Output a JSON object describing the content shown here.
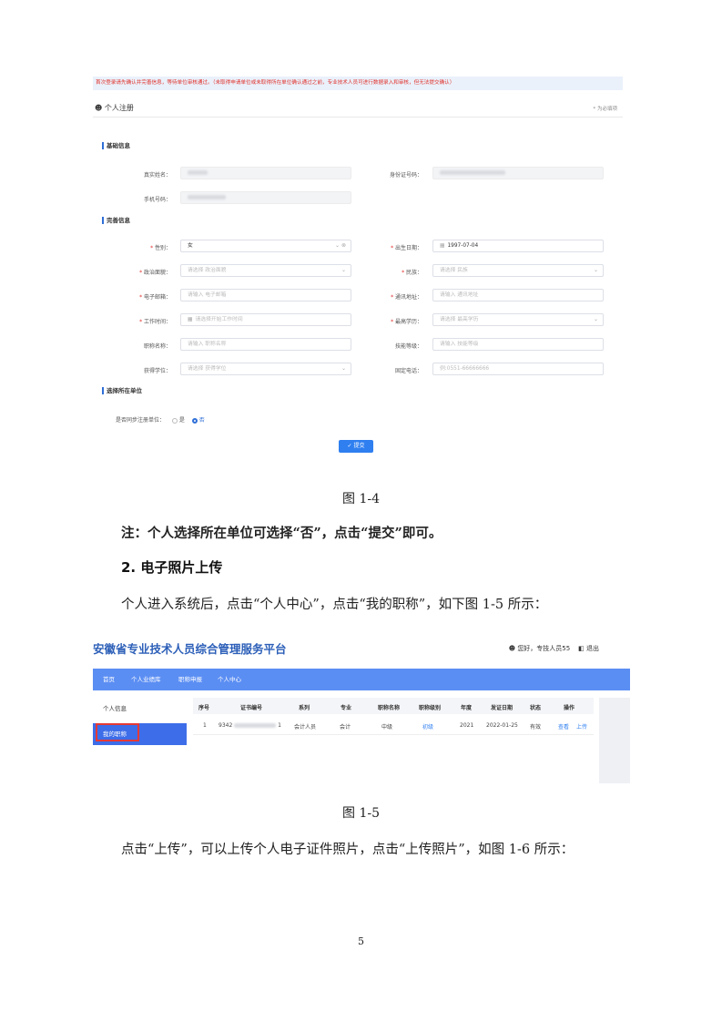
{
  "fig1": {
    "notice": "首次登录请先确认并完善信息，等待单位审核通过。（未取得申请单位或未取得所在单位确认通过之前，专业技术人员可进行数据录入和审核，但无法提交确认）",
    "reg_title": "个人注册",
    "required_hint": "* 为必填项",
    "sections": {
      "basic": "基础信息",
      "complete": "完善信息",
      "unit": "选择所在单位"
    },
    "fields": {
      "real_name": "真实姓名：",
      "id_number": "身份证号码：",
      "phone": "手机号码：",
      "gender": "性别：",
      "gender_value": "女",
      "birth": "出生日期：",
      "birth_value": "1997-07-04",
      "political": "政治面貌：",
      "political_ph": "请选择 政治面貌",
      "nation": "民族：",
      "nation_ph": "请选择 民族",
      "email": "电子邮箱：",
      "email_ph": "请输入 电子邮箱",
      "address": "通讯地址：",
      "address_ph": "请输入 通讯地址",
      "work_time": "工作时间：",
      "work_time_ph": "请选择开始工作时间",
      "education": "最高学历：",
      "education_ph": "请选择 最高学历",
      "title": "职称名称：",
      "title_ph": "请输入 职称名称",
      "skill": "技能等级：",
      "skill_ph": "请输入 技能等级",
      "degree": "获得学位：",
      "degree_ph": "请选择 获得学位",
      "fixed_phone": "固定电话：",
      "fixed_phone_ph": "例:0551-66666666"
    },
    "sync_label": "是否同步注册单位：",
    "sync_yes": "是",
    "sync_no": "否",
    "submit": "提交"
  },
  "caption1": "图 1-4",
  "note": "注：个人选择所在单位可选择“否”，点击“提交”即可。",
  "heading2": "2.  电子照片上传",
  "para1": "个人进入系统后，点击“个人中心”，点击“我的职称”，如下图 1-5 所示：",
  "fig2": {
    "platform_title": "安徽省专业技术人员综合管理服务平台",
    "greeting": "您好，专技人员55",
    "logout": "退出",
    "nav": [
      "首页",
      "个人业绩库",
      "职称申报",
      "个人中心"
    ],
    "sidebar": [
      "个人信息",
      "我的职称"
    ],
    "columns": [
      "序号",
      "证书编号",
      "系列",
      "专业",
      "职称名称",
      "职称级别",
      "年度",
      "发证日期",
      "状态",
      "操作"
    ],
    "row": {
      "no": "1",
      "cert_prefix": "9342",
      "cert_suffix": "1",
      "series": "会计人员",
      "major": "会计",
      "title": "中级",
      "level": "初级",
      "year": "2021",
      "date": "2022-01-25",
      "status": "有效",
      "view": "查看",
      "upload": "上传"
    }
  },
  "caption2": "图 1-5",
  "para2": "点击“上传”，可以上传个人电子证件照片，点击“上传照片”，如图 1-6 所示：",
  "page_number": "5"
}
